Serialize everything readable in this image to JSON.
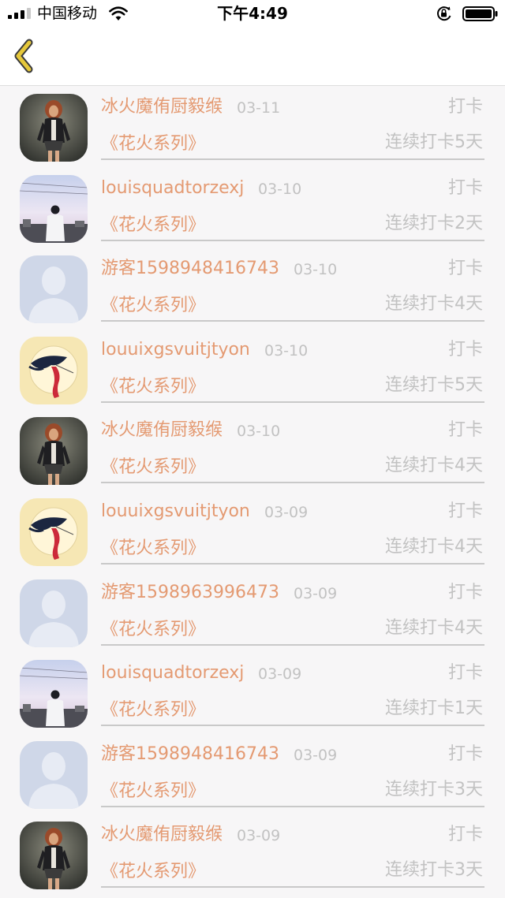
{
  "status_bar": {
    "carrier": "中国移动",
    "time": "下午4:49"
  },
  "nav": {
    "back_icon": "chevron-left-icon",
    "accent_color": "#e6c83b"
  },
  "colors": {
    "name": "#e49a72",
    "meta": "#c2c2c2"
  },
  "checkins": [
    {
      "avatar": "woman-photo",
      "name": "冰火魔侑厨毅缑",
      "date": "03-11",
      "action": "打卡",
      "series": "《花火系列》",
      "streak": "连续打卡5天"
    },
    {
      "avatar": "rooftop-photo",
      "name": "louisquadtorzexj",
      "date": "03-10",
      "action": "打卡",
      "series": "《花火系列》",
      "streak": "连续打卡2天"
    },
    {
      "avatar": "default-silhouette",
      "name": "游客1598948416743",
      "date": "03-10",
      "action": "打卡",
      "series": "《花火系列》",
      "streak": "连续打卡4天"
    },
    {
      "avatar": "art-illustration",
      "name": "louuixgsvuitjtyon",
      "date": "03-10",
      "action": "打卡",
      "series": "《花火系列》",
      "streak": "连续打卡5天"
    },
    {
      "avatar": "woman-photo",
      "name": "冰火魔侑厨毅缑",
      "date": "03-10",
      "action": "打卡",
      "series": "《花火系列》",
      "streak": "连续打卡4天"
    },
    {
      "avatar": "art-illustration",
      "name": "louuixgsvuitjtyon",
      "date": "03-09",
      "action": "打卡",
      "series": "《花火系列》",
      "streak": "连续打卡4天"
    },
    {
      "avatar": "default-silhouette",
      "name": "游客1598963996473",
      "date": "03-09",
      "action": "打卡",
      "series": "《花火系列》",
      "streak": "连续打卡4天"
    },
    {
      "avatar": "rooftop-photo",
      "name": "louisquadtorzexj",
      "date": "03-09",
      "action": "打卡",
      "series": "《花火系列》",
      "streak": "连续打卡1天"
    },
    {
      "avatar": "default-silhouette",
      "name": "游客1598948416743",
      "date": "03-09",
      "action": "打卡",
      "series": "《花火系列》",
      "streak": "连续打卡3天"
    },
    {
      "avatar": "woman-photo",
      "name": "冰火魔侑厨毅缑",
      "date": "03-09",
      "action": "打卡",
      "series": "《花火系列》",
      "streak": "连续打卡3天"
    }
  ]
}
